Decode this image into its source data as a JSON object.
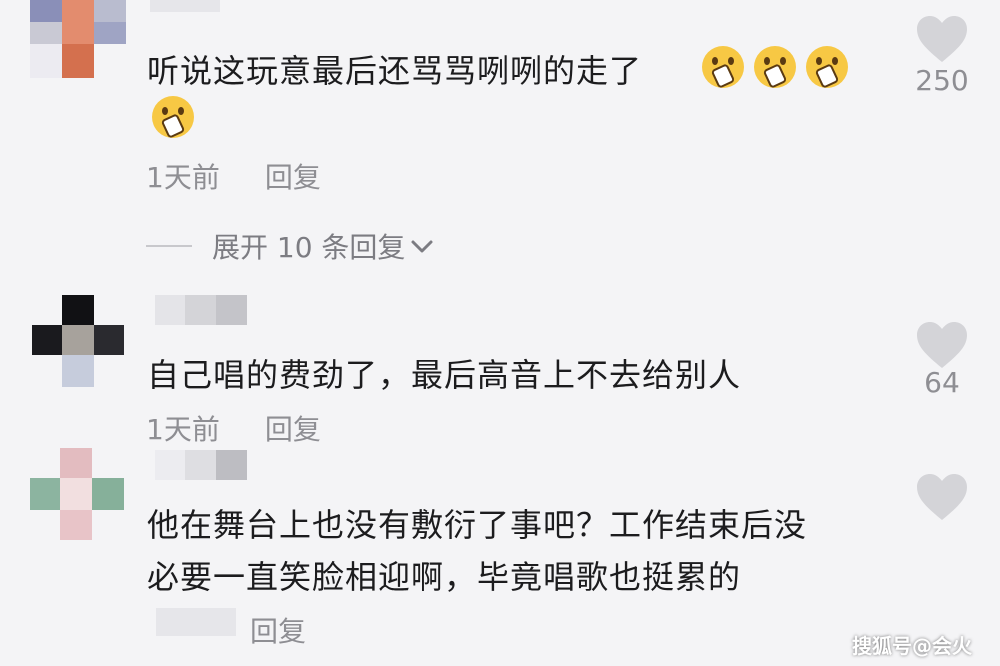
{
  "comments": [
    {
      "text": "听说这玩意最后还骂骂咧咧的走了",
      "emoji": [
        "shocked-emoji",
        "shocked-emoji",
        "shocked-emoji",
        "shocked-emoji"
      ],
      "time": "1天前",
      "reply_label": "回复",
      "likes": "250",
      "expand_label": "展开 10 条回复"
    },
    {
      "text": "自己唱的费劲了，最后高音上不去给别人",
      "time": "1天前",
      "reply_label": "回复",
      "likes": "64"
    },
    {
      "text_line1": "他在舞台上也没有敷衍了事吧？工作结束后没",
      "text_line2": "必要一直笑脸相迎啊，毕竟唱歌也挺累的",
      "reply_label": "回复"
    }
  ],
  "watermark": "搜狐号@会火",
  "colors": {
    "background": "#f4f4f6",
    "text": "#1c1c1e",
    "meta": "#8e8e93",
    "heart": "#cfcfd3"
  }
}
